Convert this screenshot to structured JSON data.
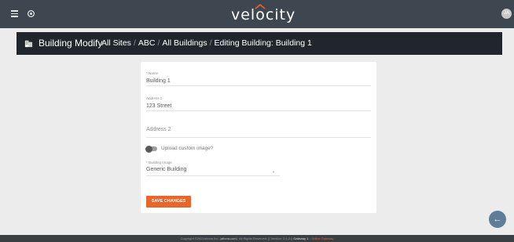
{
  "topbar": {
    "logo": "velocity",
    "avatar_initials": "JA"
  },
  "header": {
    "title": "Building Modify",
    "breadcrumb": [
      "All Sites",
      "ABC",
      "All Buildings",
      "Editing Building: Building 1"
    ]
  },
  "form": {
    "name_label": "Name",
    "name_value": "Building 1",
    "address1_label": "Address 1",
    "address1_value": "123 Street",
    "address2_placeholder": "Address 2",
    "toggle_label": "Upload custom image?",
    "building_image_label": "Building Image",
    "building_image_value": "Generic Building",
    "save_label": "SAVE CHANGES"
  },
  "footer": {
    "copyright": "Copyright ©2021Atlona Inc. (",
    "link": "atlona.com",
    "rights": "). All Rights Reserved. || Version: 2.4.2 || ",
    "gateway": "Gateway 1",
    "sep": " :: ",
    "active": "Active Gateway"
  },
  "colors": {
    "accent": "#e8652b",
    "topbar": "#3e474f",
    "header": "#20262b",
    "fab": "#5e7d99"
  }
}
